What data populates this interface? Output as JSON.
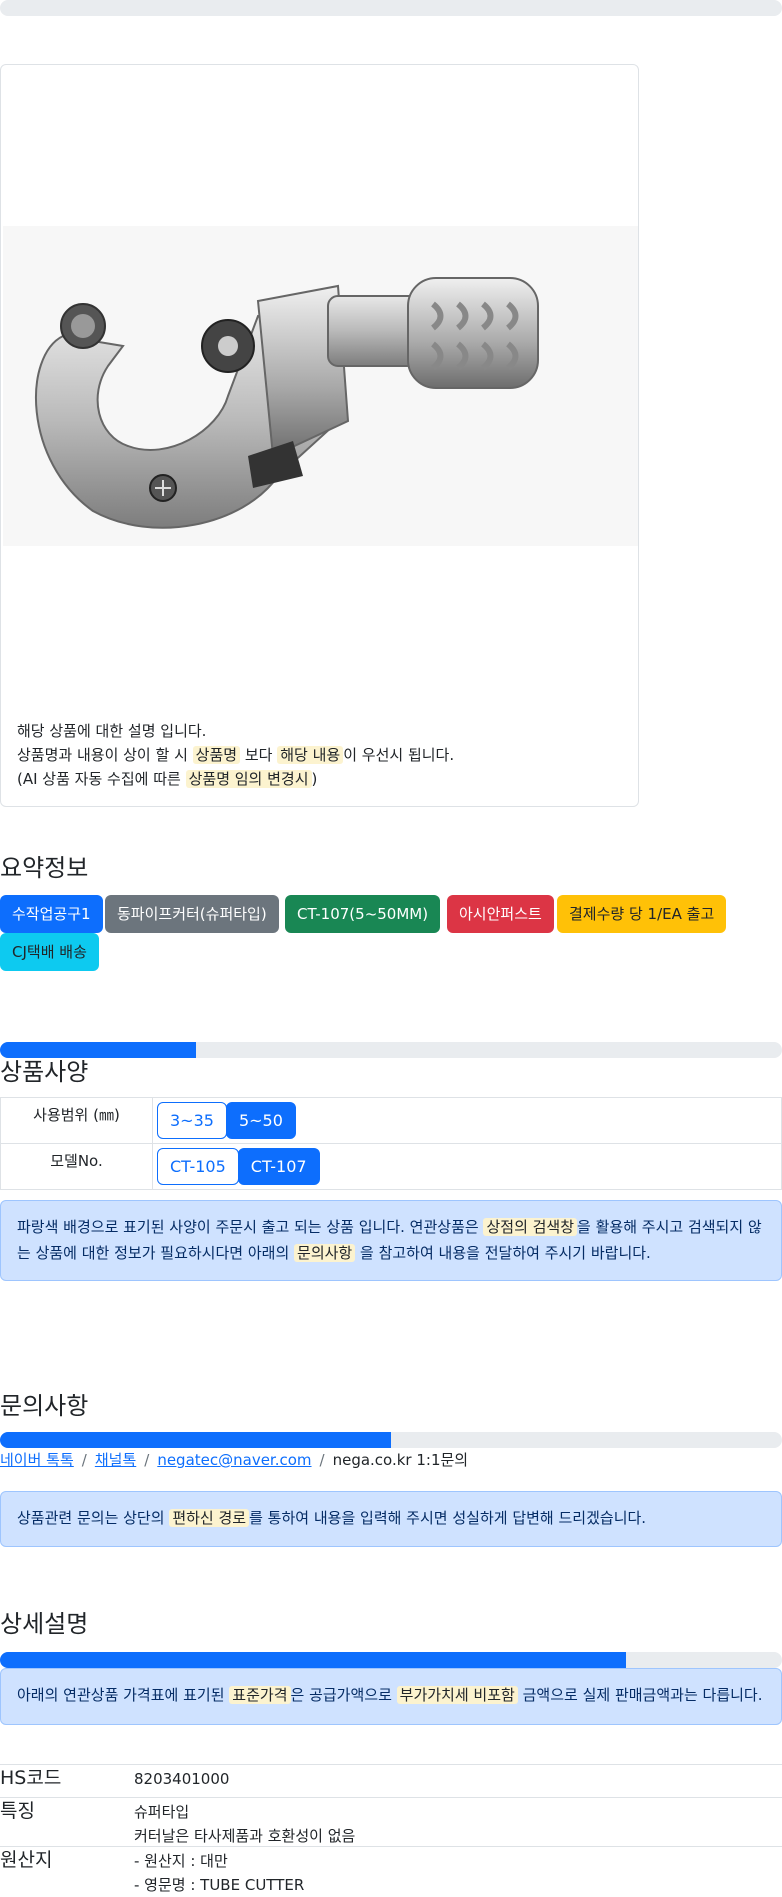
{
  "top_progress": 0,
  "product": {
    "description_lines": {
      "line1": "해당 상품에 대한 설명 입니다.",
      "line2_pre": "상품명과 내용이 상이 할 시",
      "line2_mark1": "상품명",
      "line2_mid": "보다",
      "line2_mark2": "해당 내용",
      "line2_post": "이 우선시 됩니다.",
      "line3_pre": "(AI 상품 자동 수집에 따른",
      "line3_mark": "상품명 임의 변경시",
      "line3_post": ")"
    }
  },
  "summary": {
    "title": "요약정보",
    "badges": [
      "수작업공구1",
      "동파이프커터(슈퍼타입)",
      "CT-107(5~50MM)",
      "아시안퍼스트",
      "결제수량 당 1/EA 출고",
      "CJ택배 배송"
    ]
  },
  "spec": {
    "title": "상품사양",
    "progress": 0.25,
    "rows": [
      {
        "label": "사용범위 (㎜)",
        "options": [
          "3~35",
          "5~50"
        ],
        "selected": "5~50"
      },
      {
        "label": "모델No.",
        "options": [
          "CT-105",
          "CT-107"
        ],
        "selected": "CT-107"
      }
    ],
    "notice": {
      "pre": "파랑색 배경으로 표기된 사양이 주문시 출고 되는 상품 입니다. 연관상품은",
      "mark1": "상점의 검색창",
      "mid": "을 활용해 주시고 검색되지 않는 상품에 대한 정보가 필요하시다면 아래의",
      "mark2": "문의사항",
      "post": "을 참고하여 내용을 전달하여 주시기 바랍니다."
    }
  },
  "inquiry": {
    "title": "문의사항",
    "progress": 0.5,
    "links": [
      "네이버 톡톡",
      "채널톡",
      "negatec@naver.com"
    ],
    "plain": "nega.co.kr 1:1문의",
    "notice": {
      "pre": "상품관련 문의는 상단의",
      "mark": "편하신 경로",
      "post": "를 통하여 내용을 입력해 주시면 성실하게 답변해 드리겠습니다."
    }
  },
  "detail": {
    "title": "상세설명",
    "progress": 0.8,
    "notice": {
      "pre": "아래의 연관상품 가격표에 표기된",
      "mark1": "표준가격",
      "mid": "은 공급가액으로",
      "mark2": "부가가치세 비포함",
      "post": "금액으로 실제 판매금액과는 다릅니다."
    },
    "rows": [
      {
        "key": "HS코드",
        "values": [
          "8203401000"
        ]
      },
      {
        "key": "특징",
        "values": [
          "슈퍼타입",
          "커터날은 타사제품과 호환성이 없음"
        ]
      },
      {
        "key": "원산지",
        "values": [
          "- 원산지 : 대만",
          "- 영문명 : TUBE CUTTER"
        ]
      }
    ]
  },
  "colors": {
    "primary": "#0d6efd",
    "notice_bg": "#cfe2ff",
    "highlight": "#fcf3cf"
  }
}
